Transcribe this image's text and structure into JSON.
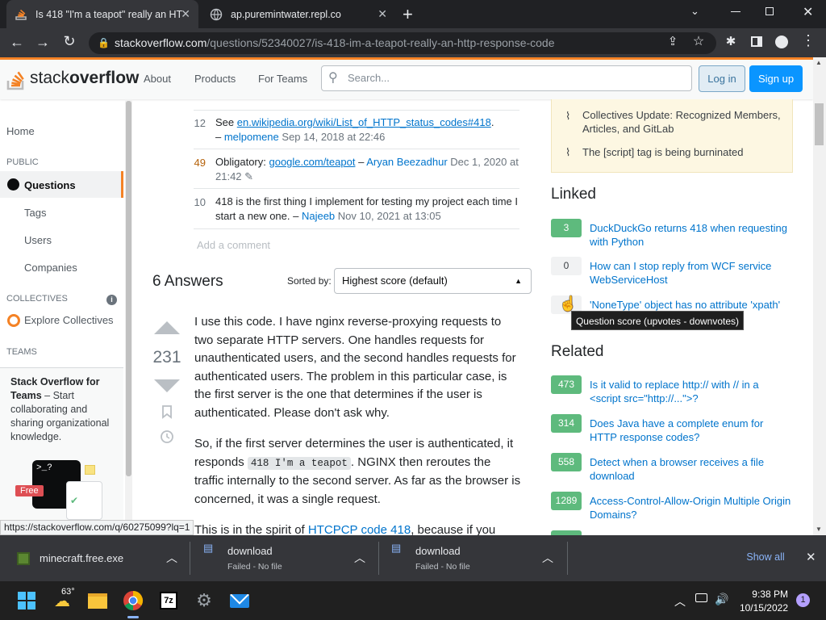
{
  "browser": {
    "tabs": [
      {
        "title": "Is 418 \"I'm a teapot\" really an HT",
        "active": true
      },
      {
        "title": "ap.puremintwater.repl.co",
        "active": false
      }
    ],
    "new_tab_label": "+",
    "url_host": "stackoverflow.com",
    "url_path": "/questions/52340027/is-418-im-a-teapot-really-an-http-response-code"
  },
  "so_header": {
    "logo_text_light": "stack",
    "logo_text_bold": "overflow",
    "nav": [
      "About",
      "Products",
      "For Teams"
    ],
    "search_placeholder": "Search...",
    "login": "Log in",
    "signup": "Sign up"
  },
  "left_nav": {
    "home": "Home",
    "public_header": "PUBLIC",
    "questions": "Questions",
    "tags": "Tags",
    "users": "Users",
    "companies": "Companies",
    "collectives_header": "COLLECTIVES",
    "explore_collectives": "Explore Collectives",
    "teams_header": "TEAMS",
    "teams_title": "Stack Overflow for Teams",
    "teams_body": " – Start collaborating and sharing organizational knowledge.",
    "free_badge": "Free"
  },
  "comments": [
    {
      "score": "12",
      "pre": "See ",
      "link": "en.wikipedia.org/wiki/List_of_HTTP_status_codes#418",
      "post": ".",
      "author": "melpomene",
      "date": "Sep 14, 2018 at 22:46"
    },
    {
      "score": "49",
      "pre": "Obligatory: ",
      "link": "google.com/teapot",
      "post": "",
      "author": "Aryan Beezadhur",
      "date": "Dec 1, 2020 at 21:42"
    },
    {
      "score": "10",
      "pre": "418 is the first thing I implement for testing my project each time I start a new one.",
      "link": "",
      "post": "",
      "author": "Najeeb",
      "date": "Nov 10, 2021 at 13:05"
    }
  ],
  "add_comment": "Add a comment",
  "answers": {
    "count_label": "6 Answers",
    "sorted_by": "Sorted by:",
    "sort_value": "Highest score (default)",
    "vote_score": "231",
    "para1": "I use this code. I have nginx reverse-proxying requests to two separate HTTP servers. One handles requests for unauthenticated users, and the second handles requests for authenticated users. The problem in this particular case, is the first server is the one that determines if the user is authenticated. Please don't ask why.",
    "para2_a": "So, if the first server determines the user is authenticated, it responds ",
    "para2_code": "418 I'm a teapot",
    "para2_b": ". NGINX then reroutes the traffic internally to the second server. As far as the browser is concerned, it was a single request.",
    "para3_a": "This is in the spirit of ",
    "para3_link": "HTCPCP code 418",
    "para3_b": ", because if you"
  },
  "right": {
    "featured": [
      "Collectives Update: Recognized Members, Articles, and GitLab",
      "The [script] tag is being burninated"
    ],
    "linked_title": "Linked",
    "linked": [
      {
        "score": "3",
        "accepted": true,
        "title": "DuckDuckGo returns 418 when requesting with Python"
      },
      {
        "score": "0",
        "accepted": false,
        "title": "How can I stop reply from WCF service WebServiceHost"
      },
      {
        "score": "",
        "accepted": false,
        "title": "'NoneType' object has no attribute 'xpath'"
      }
    ],
    "tooltip": "Question score (upvotes - downvotes)",
    "related_title": "Related",
    "related": [
      {
        "score": "473",
        "title": "Is it valid to replace http:// with // in a <script src=\"http://...\">?"
      },
      {
        "score": "314",
        "title": "Does Java have a complete enum for HTTP response codes?"
      },
      {
        "score": "558",
        "title": "Detect when a browser receives a file download"
      },
      {
        "score": "1289",
        "title": "Access-Control-Allow-Origin Multiple Origin Domains?"
      }
    ]
  },
  "status_url": "https://stackoverflow.com/q/60275099?lq=1",
  "downloads": [
    {
      "name": "minecraft.free.exe",
      "status": ""
    },
    {
      "name": "download",
      "status": "Failed - No file"
    },
    {
      "name": "download",
      "status": "Failed - No file"
    }
  ],
  "show_all": "Show all",
  "taskbar": {
    "temp": "63°",
    "time": "9:38 PM",
    "date": "10/15/2022",
    "notif_count": "1"
  }
}
